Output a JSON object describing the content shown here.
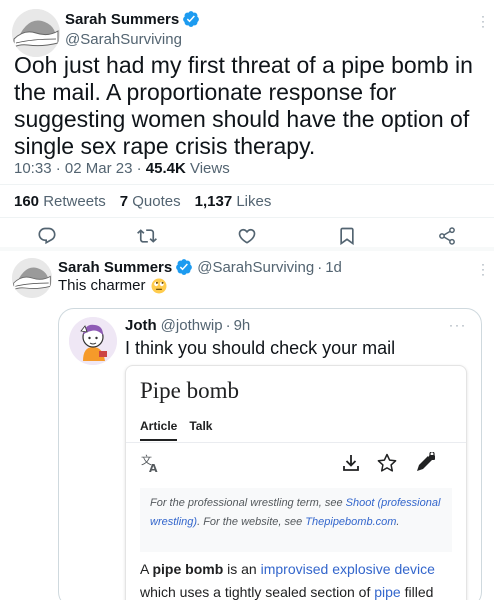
{
  "post": {
    "author": {
      "name": "Sarah Summers",
      "handle": "@SarahSurviving"
    },
    "text": "Ooh just had my first threat of a pipe bomb in the mail. A proportionate response for suggesting women should have the option of single sex rape crisis therapy.",
    "time": "10:33",
    "separator": "·",
    "date": "02 Mar 23",
    "views_count": "45.4K",
    "views_label": "Views",
    "stats": {
      "retweets_count": "160",
      "retweets_label": "Retweets",
      "quotes_count": "7",
      "quotes_label": "Quotes",
      "likes_count": "1,137",
      "likes_label": "Likes"
    },
    "actions": [
      "reply-icon",
      "retweet-icon",
      "like-icon",
      "bookmark-icon",
      "share-icon"
    ]
  },
  "reply": {
    "author": {
      "name": "Sarah Summers",
      "handle": "@SarahSurviving",
      "separator": "·",
      "age": "1d"
    },
    "text": "This charmer",
    "emoji": "rolling-eyes-emoji",
    "quote": {
      "author": {
        "name": "Joth",
        "handle": "@jothwip",
        "separator": "·",
        "age": "9h"
      },
      "text": "I think you should check your mail",
      "wiki": {
        "title": "Pipe bomb",
        "tabs": [
          "Article",
          "Talk"
        ],
        "icons": [
          "translate-icon",
          "download-icon",
          "star-icon",
          "edit-lock-icon"
        ],
        "hatnote": {
          "pre": "For the professional wrestling term, see ",
          "link": "Shoot (professional wrestling)",
          "mid": ". For the website, see ",
          "link2": "Thepipebomb.com",
          "post": "."
        },
        "body": {
          "pre": "A ",
          "bold": "pipe bomb",
          "mid": " is an ",
          "link1": "improvised explosive device",
          "mid2": " which uses a tightly sealed section of ",
          "link2": "pipe",
          "post": " filled"
        }
      }
    }
  },
  "colors": {
    "verified": "#1d9bf0",
    "link": "#3366cc",
    "secondary_text": "#536471"
  }
}
